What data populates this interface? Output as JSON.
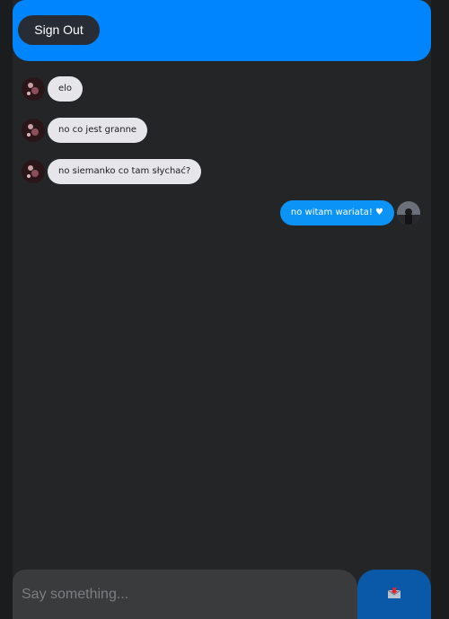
{
  "header": {
    "signout_label": "Sign Out"
  },
  "messages": [
    {
      "direction": "received",
      "text": "elo",
      "avatar": "user-avatar-icon"
    },
    {
      "direction": "received",
      "text": "no co jest granne",
      "avatar": "user-avatar-icon"
    },
    {
      "direction": "received",
      "text": "no siemanko co tam słychać?",
      "avatar": "user-avatar-icon"
    },
    {
      "direction": "sent",
      "text": "no witam wariata!",
      "emoji": "♥",
      "avatar": "user-avatar-icon"
    }
  ],
  "composer": {
    "placeholder": "Say something...",
    "send_icon": "send-mail-icon"
  },
  "colors": {
    "header": "#0185fe",
    "received_bubble": "#e5e5ea",
    "sent_bubble": "#0b93f6",
    "send_button": "#0a58a8",
    "background": "#242526"
  }
}
